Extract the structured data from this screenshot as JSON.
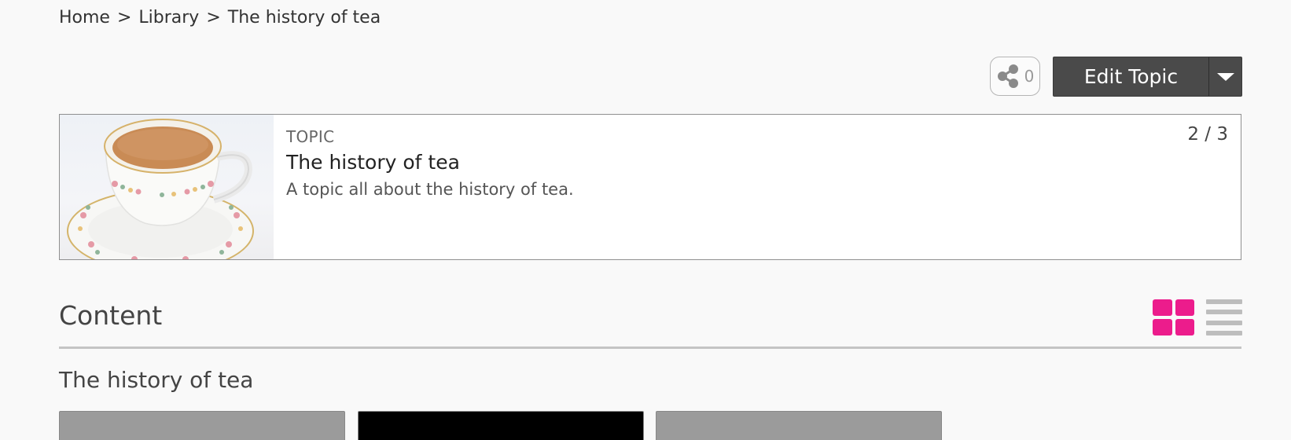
{
  "breadcrumb": {
    "items": [
      "Home",
      "Library",
      "The history of tea"
    ],
    "separator": ">"
  },
  "actions": {
    "share_count": "0",
    "edit_label": "Edit Topic"
  },
  "topic": {
    "kind": "TOPIC",
    "title": "The history of tea",
    "description": "A topic all about the history of tea.",
    "pager": "2 / 3"
  },
  "content": {
    "heading": "Content",
    "section_title": "The history of tea",
    "accent_color": "#ec1c8c",
    "tiles": [
      {
        "color": "#9b9b9b"
      },
      {
        "color": "#000000"
      },
      {
        "color": "#9b9b9b"
      }
    ]
  }
}
